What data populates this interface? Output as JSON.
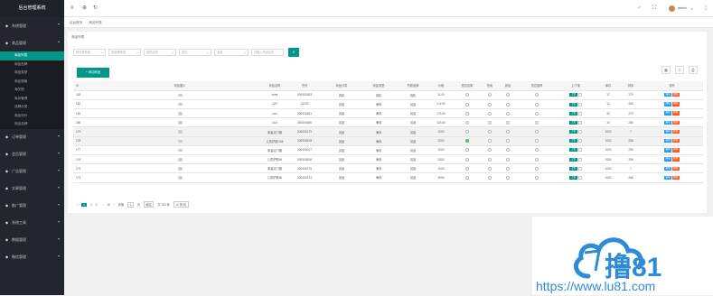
{
  "sidebar": {
    "title": "后台管理系统",
    "menus": [
      {
        "label": "系统管理",
        "icon": "gear-icon",
        "expanded": false
      },
      {
        "label": "商品管理",
        "icon": "chart-icon",
        "expanded": true,
        "children": [
          "商品列表",
          "商品品牌",
          "商品类型",
          "商品规格",
          "海关税",
          "库存管理",
          "品牌分类",
          "商品评价",
          "商品品牌"
        ]
      },
      {
        "label": "订单管理",
        "icon": "order-icon",
        "expanded": false
      },
      {
        "label": "会员管理",
        "icon": "user-icon",
        "expanded": false
      },
      {
        "label": "广告管理",
        "icon": "ad-icon",
        "expanded": false
      },
      {
        "label": "文章管理",
        "icon": "doc-icon",
        "expanded": false
      },
      {
        "label": "推广管理",
        "icon": "promo-icon",
        "expanded": false
      },
      {
        "label": "系统工具",
        "icon": "tool-icon",
        "expanded": false
      },
      {
        "label": "数据管理",
        "icon": "data-icon",
        "expanded": false
      },
      {
        "label": "微信管理",
        "icon": "wechat-icon",
        "expanded": false
      }
    ]
  },
  "topbar": {
    "user": "admin"
  },
  "tabs": {
    "home": "后台首页",
    "current": "商品列表"
  },
  "card": {
    "section_title": "商品列表",
    "filters": [
      "按分类筛选",
      "按品牌筛选",
      "按供应商",
      "是否",
      "全部",
      "请输入商品名称"
    ],
    "add_button": "+ 添加商品"
  },
  "table": {
    "headers": [
      "ID",
      "商品图片",
      "商品名称",
      "货号",
      "商品分类",
      "商品类型",
      "所属品牌",
      "价格",
      "是否包邮",
      "热卖",
      "新品",
      "是否推荐",
      "上/下架",
      "库存",
      "排序",
      "操作"
    ],
    "rows": [
      {
        "id": "183",
        "name": "ceee",
        "sn": "000000183",
        "cat": "真机",
        "type": "真机",
        "brand": "真机",
        "price": "11.00",
        "free": false,
        "stock": "17",
        "sort": "270"
      },
      {
        "id": "182",
        "name": "123",
        "sn": "12233",
        "cat": "另品",
        "type": "海淘",
        "brand": "另品",
        "price": "2.4/.00",
        "free": false,
        "stock": "12",
        "sort": "266"
      },
      {
        "id": "181",
        "name": "cccl",
        "sn": "000000181",
        "cat": "另品",
        "type": "海淘",
        "brand": "另品",
        "price": "173.00",
        "free": false,
        "stock": "30",
        "sort": "270"
      },
      {
        "id": "180",
        "name": "ccd",
        "sn": "000000180",
        "cat": "另品",
        "type": "海淘",
        "brand": "另品",
        "price": "123.00",
        "free": false,
        "stock": "10",
        "sort": "256"
      },
      {
        "id": "179",
        "name": "泰金北门钢",
        "sn": "000000179",
        "cat": "另品",
        "type": "海淘",
        "brand": "另品",
        "price": "1000",
        "free": false,
        "stock": "1000",
        "sort": "7"
      },
      {
        "id": "178",
        "name": "儿童护肤OMI",
        "sn": "000000518",
        "cat": "另品",
        "type": "海淘",
        "brand": "另品",
        "price": "2000",
        "free": true,
        "stock": "1000",
        "sort": "256"
      },
      {
        "id": "177",
        "name": "泰金北门钢",
        "sn": "000000017",
        "cat": "另品",
        "type": "海淘",
        "brand": "另品",
        "price": "2000",
        "free": false,
        "stock": "1000",
        "sort": "256"
      },
      {
        "id": "176",
        "name": "儿童护肤MI",
        "sn": "000000516",
        "cat": "另品",
        "type": "海淘",
        "brand": "另品",
        "price": "2000",
        "free": false,
        "stock": "1000",
        "sort": "256"
      },
      {
        "id": "175",
        "name": "泰金北门钢",
        "sn": "000000175",
        "cat": "另品",
        "type": "海淘",
        "brand": "另品",
        "price": "1000",
        "free": false,
        "stock": "1000",
        "sort": "7"
      },
      {
        "id": "174",
        "name": "儿童护肤MI",
        "sn": "000000174",
        "cat": "另品",
        "type": "海淘",
        "brand": "另品",
        "price": "3000",
        "free": false,
        "stock": "1000",
        "sort": "256"
      }
    ],
    "switch_label": "上架",
    "edit": "编辑",
    "del": "删除"
  },
  "pager": {
    "pages": [
      "1",
      "2",
      "3",
      "...",
      "18"
    ],
    "goto_label": "到第",
    "page_input": "1",
    "page_unit": "页",
    "confirm": "确定",
    "total": "共 183 条",
    "per_page": "10 条/页"
  },
  "watermark": {
    "text": "撸81",
    "url": "https://www.lu81.com"
  }
}
